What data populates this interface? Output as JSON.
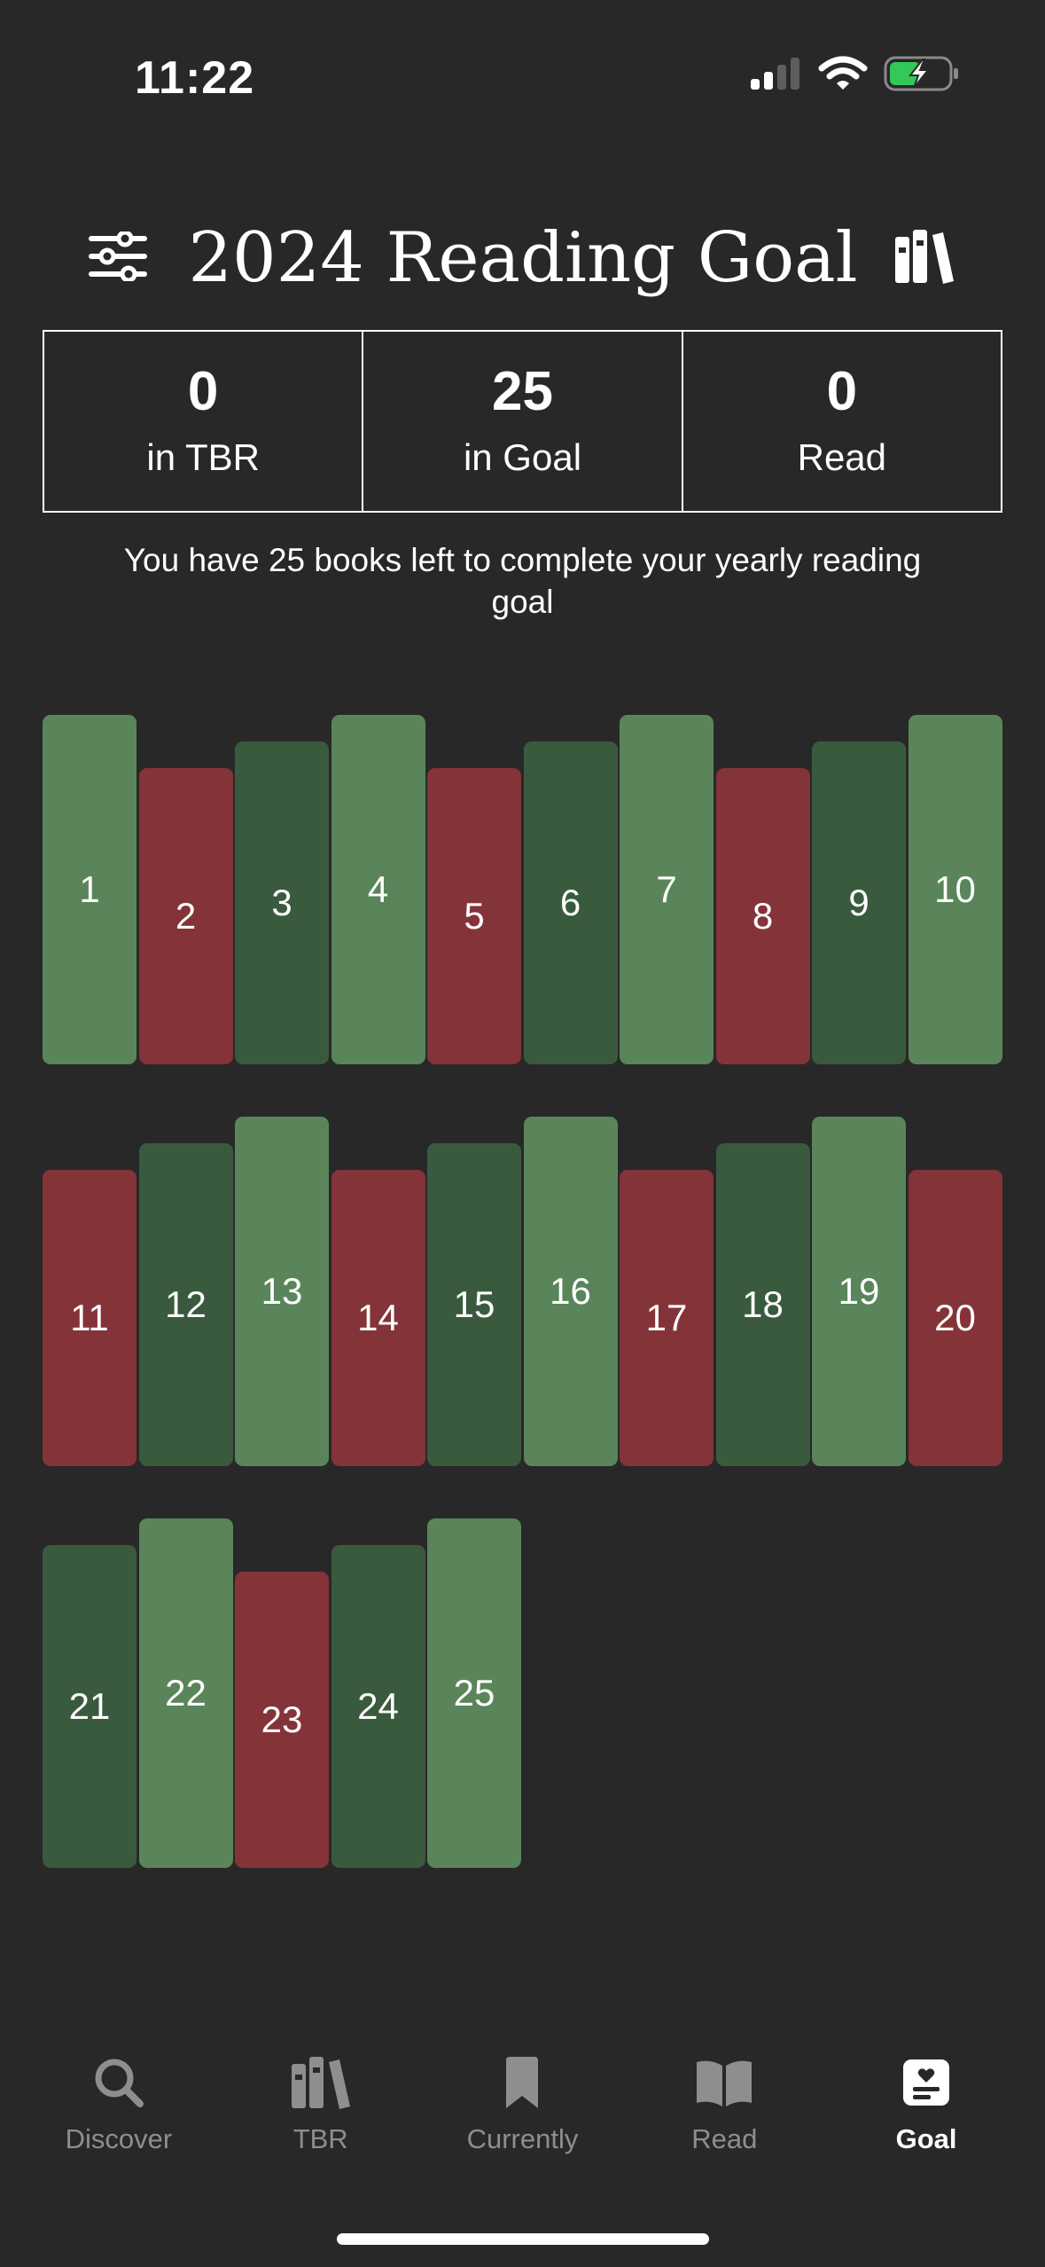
{
  "status_bar": {
    "time": "11:22",
    "icons": [
      "cellular-signal-icon",
      "wifi-icon",
      "battery-charging-icon"
    ]
  },
  "header": {
    "title": "2024 Reading Goal",
    "left_icon": "sliders-icon",
    "right_icon": "books-icon"
  },
  "stats": [
    {
      "value": "0",
      "label": "in TBR"
    },
    {
      "value": "25",
      "label": "in Goal"
    },
    {
      "value": "0",
      "label": "Read"
    }
  ],
  "summary": "You have 25 books left to complete your yearly reading goal",
  "colors": {
    "background": "#282828",
    "book_light_green": "#5a855a",
    "book_dark_green": "#3a5a3e",
    "book_red": "#843339"
  },
  "shelves": [
    {
      "books": [
        {
          "label": "1",
          "style": "tall"
        },
        {
          "label": "2",
          "style": "short"
        },
        {
          "label": "3",
          "style": "mid"
        },
        {
          "label": "4",
          "style": "tall"
        },
        {
          "label": "5",
          "style": "short"
        },
        {
          "label": "6",
          "style": "mid"
        },
        {
          "label": "7",
          "style": "tall"
        },
        {
          "label": "8",
          "style": "short"
        },
        {
          "label": "9",
          "style": "mid"
        },
        {
          "label": "10",
          "style": "tall"
        }
      ]
    },
    {
      "books": [
        {
          "label": "11",
          "style": "short"
        },
        {
          "label": "12",
          "style": "mid"
        },
        {
          "label": "13",
          "style": "tall"
        },
        {
          "label": "14",
          "style": "short"
        },
        {
          "label": "15",
          "style": "mid"
        },
        {
          "label": "16",
          "style": "tall"
        },
        {
          "label": "17",
          "style": "short"
        },
        {
          "label": "18",
          "style": "mid"
        },
        {
          "label": "19",
          "style": "tall"
        },
        {
          "label": "20",
          "style": "short"
        }
      ]
    },
    {
      "books": [
        {
          "label": "21",
          "style": "mid"
        },
        {
          "label": "22",
          "style": "tall"
        },
        {
          "label": "23",
          "style": "short"
        },
        {
          "label": "24",
          "style": "mid"
        },
        {
          "label": "25",
          "style": "tall"
        }
      ]
    }
  ],
  "tabs": [
    {
      "label": "Discover",
      "icon": "search-icon",
      "active": false
    },
    {
      "label": "TBR",
      "icon": "books-icon",
      "active": false
    },
    {
      "label": "Currently",
      "icon": "bookmark-icon",
      "active": false
    },
    {
      "label": "Read",
      "icon": "open-book-icon",
      "active": false
    },
    {
      "label": "Goal",
      "icon": "goal-icon",
      "active": true
    }
  ]
}
